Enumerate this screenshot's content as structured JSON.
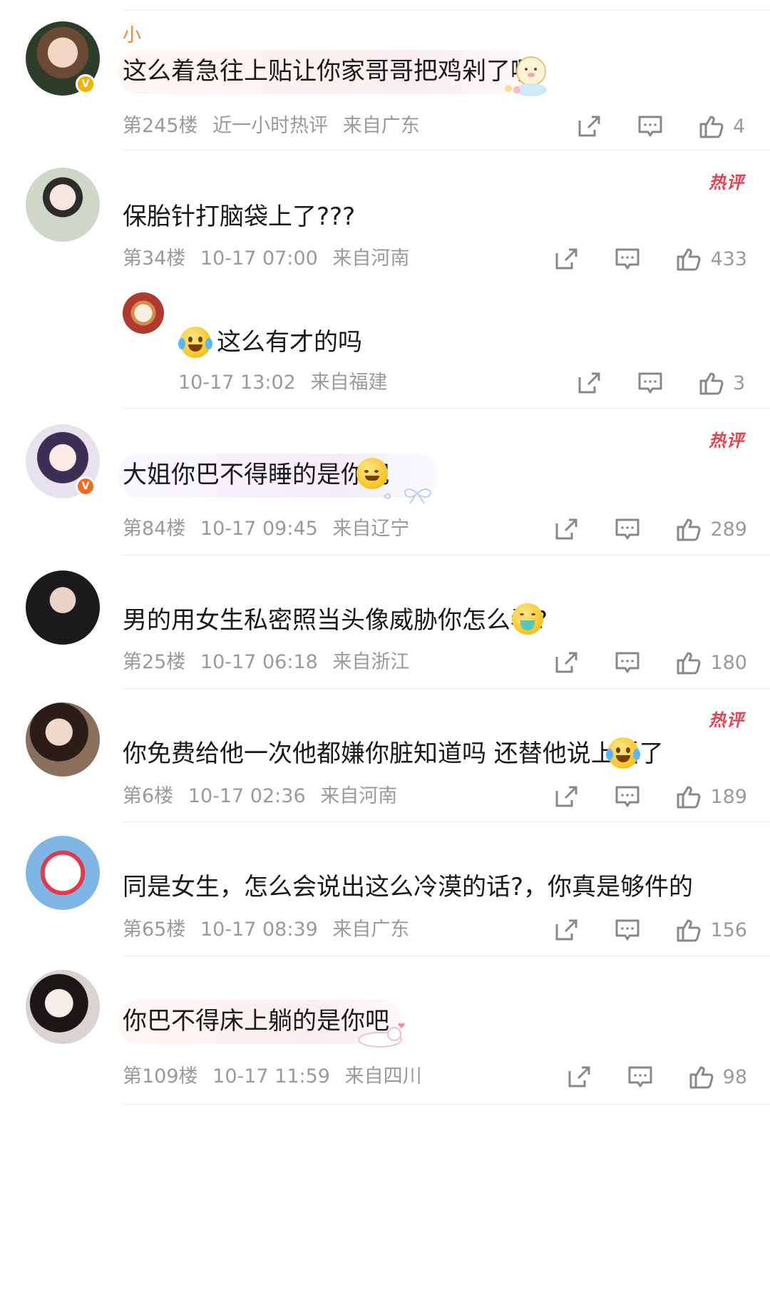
{
  "comments": [
    {
      "username": "小",
      "text": "这么着急往上贴让你家哥哥把鸡剁了啊",
      "floor": "第245楼",
      "extra": "近一小时热评",
      "location": "来自广东",
      "likes": "4",
      "hot_badge": ""
    },
    {
      "username": "",
      "text": "保胎针打脑袋上了???",
      "floor": "第34楼",
      "time": "10-17 07:00",
      "location": "来自河南",
      "likes": "433",
      "hot_badge": "热评"
    },
    {
      "username": "",
      "text": "这么有才的吗",
      "time": "10-17 13:02",
      "location": "来自福建",
      "likes": "3"
    },
    {
      "username": "",
      "text": "大姐你巴不得睡的是你吧",
      "floor": "第84楼",
      "time": "10-17 09:45",
      "location": "来自辽宁",
      "likes": "289",
      "hot_badge": "热评"
    },
    {
      "username": "",
      "text": "男的用女生私密照当头像威胁你怎么看?",
      "floor": "第25楼",
      "time": "10-17 06:18",
      "location": "来自浙江",
      "likes": "180"
    },
    {
      "username": "",
      "text": "你免费给他一次他都嫌你脏知道吗 还替他说上话了",
      "floor": "第6楼",
      "time": "10-17 02:36",
      "location": "来自河南",
      "likes": "189",
      "hot_badge": "热评"
    },
    {
      "username": "",
      "text": "同是女生，怎么会说出这么冷漠的话?，你真是够件的",
      "floor": "第65楼",
      "time": "10-17 08:39",
      "location": "来自广东",
      "likes": "156"
    },
    {
      "username": "",
      "text": "你巴不得床上躺的是你吧",
      "floor": "第109楼",
      "time": "10-17 11:59",
      "location": "来自四川",
      "likes": "98"
    }
  ],
  "icons": {
    "share": "share-icon",
    "reply": "comment-icon",
    "like": "thumbs-up-icon"
  },
  "colors": {
    "hot_badge": "#e8404f",
    "meta_text": "#9a9a9a",
    "username": "#e98a30",
    "verified_gold": "#f5b000",
    "verified_orange": "#f0691f"
  }
}
